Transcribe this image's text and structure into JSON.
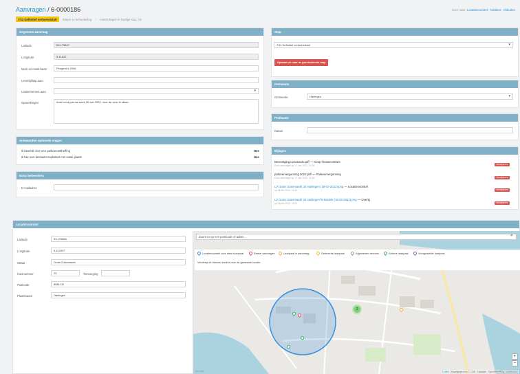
{
  "breadcrumb": {
    "parent": "Aanvragen",
    "separator": "/",
    "current": "6-0000186"
  },
  "topnav": {
    "prefix": "Snel naar:",
    "items": [
      "Locatievoorstel",
      "Notities",
      "Afsluiten"
    ],
    "sep": "-"
  },
  "status": {
    "badge": "7/11 Definitief verbeesdsluit",
    "steps": [
      "Status: in behandeling",
      "›",
      "Aantal dagen in huidige stap: 51"
    ]
  },
  "panels": {
    "aanvraag": {
      "title": "Gegevens aanvraag",
      "fields": [
        {
          "label": "Latitude",
          "value": "53.175847"
        },
        {
          "label": "Longitude",
          "value": "5.41622"
        },
        {
          "label": "Merk en model auto",
          "value": "Peugeot e-2008"
        },
        {
          "label": "Levertijdstip auto",
          "value": ""
        },
        {
          "label": "Leasemoment auto",
          "value": ""
        },
        {
          "label": "Opmerkingen",
          "value": "Auto komt pas na week 26 van 2022, voor de deur te staan"
        }
      ]
    },
    "stap": {
      "title": "Stap",
      "select_value": "7/11 Definitief verbeesdsluit",
      "button": "Opslaan en naar de geselecteerde stap"
    },
    "gemeente": {
      "title": "Gemeente",
      "label": "Gemeente",
      "value": "Harlingen"
    },
    "publicatie": {
      "title": "Publicatie",
      "label": "Datum",
      "value": ""
    },
    "bijlagen": {
      "title": "Bijlagen",
      "delete_label": "Verwijderen",
      "items": [
        {
          "name": "Bevestiging Leaseauto.pdf",
          "suffix": " — Koop-/leasecontract",
          "meta": "Door aanvrager op 17 Jan 2022, 14:30",
          "link": false
        },
        {
          "name": "parkeervergunning 2022.pdf",
          "suffix": " — Parkeervergunning",
          "meta": "Door aanvrager op 17 Jan 2022, 14:30",
          "link": false
        },
        {
          "name": "LV Grote Gasemaeth 25 Harlingen (18-03-2022).png",
          "suffix": " — Locatievoorstel",
          "meta": "op 18 Mrt 2022, 14:12",
          "link": true
        },
        {
          "name": "LV Grote Gasemaeth 25 Harlingen fietsindek (18-03-2022).png",
          "suffix": " — Overig",
          "meta": "op 18 Mrt 2022, 14:12",
          "link": true
        }
      ]
    },
    "vragen": {
      "title": "Antwoorden optionele vragen",
      "rows": [
        {
          "q": "Ik beschik over een parkeeronttheffing",
          "a": "Nee"
        },
        {
          "q": "Ik ben een deelauto-exploitant met vaste plaats",
          "a": "Nee"
        }
      ]
    },
    "beheerders": {
      "title": "Extra beheerders",
      "label": "E-mailadres",
      "value": ""
    },
    "laadpaal": {
      "title": "Laadpaal"
    },
    "locatie": {
      "title": "Locatievoorstel",
      "fields": [
        {
          "label": "Latitude",
          "value": "53.175683"
        },
        {
          "label": "Longitude",
          "value": "5.412507"
        },
        {
          "label": "Straat",
          "value": "Grote Gasemaeth"
        },
        {
          "label": "Huisnummer",
          "value": "25",
          "extra_label": "Toevoeging",
          "extra_value": ""
        },
        {
          "label": "Postcode",
          "value": "8861CN"
        },
        {
          "label": "Plaatsnaam",
          "value": "Harlingen"
        }
      ]
    }
  },
  "map": {
    "search_placeholder": "Zoom to op een postcode of adres...",
    "legend": [
      {
        "label": "Locatievoorstel voor deze laadpaal",
        "color": "#3a8fd9"
      },
      {
        "label": "Eerste aanvragen",
        "color": "#e55353"
      },
      {
        "label": "Laadpaal in aanvraag",
        "color": "#f0ad4e"
      },
      {
        "label": "Geleverde laadpaal",
        "color": "#f0c419"
      },
      {
        "label": "Afgewezen verzoek",
        "color": "#999999"
      },
      {
        "label": "Actieve laadpaal",
        "color": "#3cb371"
      },
      {
        "label": "Voorgestelde laadpaal",
        "color": "#9b59b6"
      }
    ],
    "hint": "Versleep de blauwe marker naar de gewenste locatie",
    "zoom_in": "+",
    "zoom_out": "−",
    "cluster_count": "2",
    "google": "Google",
    "attribution_prefix": "Leaflet",
    "attribution_rest": " | Kaartgegevens © CBS, Kadaster, OpenStreetMap contributors"
  }
}
